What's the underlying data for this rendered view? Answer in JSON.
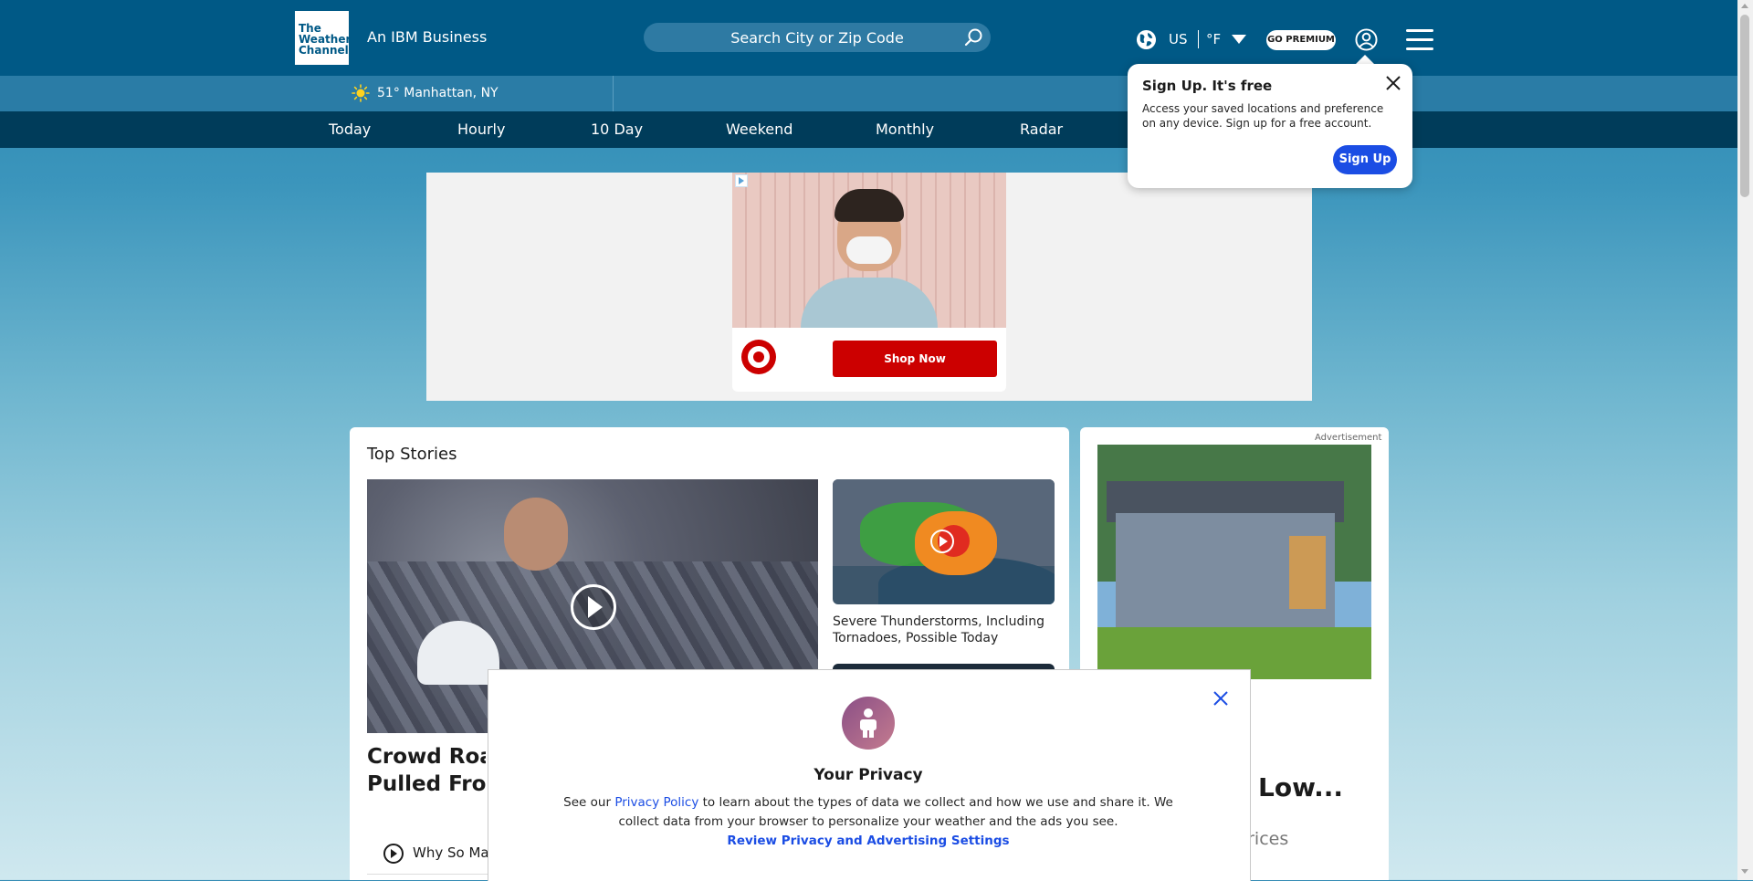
{
  "header": {
    "logo_lines": [
      "The",
      "Weather",
      "Channel"
    ],
    "tagline": "An IBM Business",
    "search_placeholder": "Search City or Zip Code",
    "locale": "US",
    "unit": "°F",
    "premium_label": "GO PREMIUM"
  },
  "current": {
    "temp_location": "51° Manhattan, NY"
  },
  "nav": {
    "items": [
      "Today",
      "Hourly",
      "10 Day",
      "Weekend",
      "Monthly",
      "Radar"
    ]
  },
  "top_ad": {
    "cta": "Shop Now",
    "brand_icon": "target-logo"
  },
  "top_stories": {
    "title": "Top Stories",
    "main_headline": "Crowd Roars as Child Is Pulled From",
    "main_headline_visible_line1": "Crowd Roar",
    "main_headline_visible_line2": "Pulled From",
    "side_caption": "Severe Thunderstorms, Including Tornadoes, Possible Today",
    "sub_link": "Why So Ma"
  },
  "right_ad": {
    "label": "Advertisement",
    "headline_fragment": "Low...",
    "sub_fragment": "Prices"
  },
  "signup_popover": {
    "title": "Sign Up. It's free",
    "body": "Access your saved locations and preference on any device. Sign up for a free account.",
    "button": "Sign Up"
  },
  "privacy_modal": {
    "title": "Your Privacy",
    "text_before": "See our ",
    "link": "Privacy Policy",
    "text_after": " to learn about the types of data we collect and how we use and share it. We collect data from your browser to personalize your weather and the ads you see.",
    "settings_link": "Review Privacy and Advertising Settings"
  },
  "colors": {
    "header_bg": "#005986",
    "subbar_bg": "#2a7ca6",
    "nav_bg": "#003c5a",
    "accent_blue": "#1b4de4",
    "ad_red": "#cc0000"
  }
}
